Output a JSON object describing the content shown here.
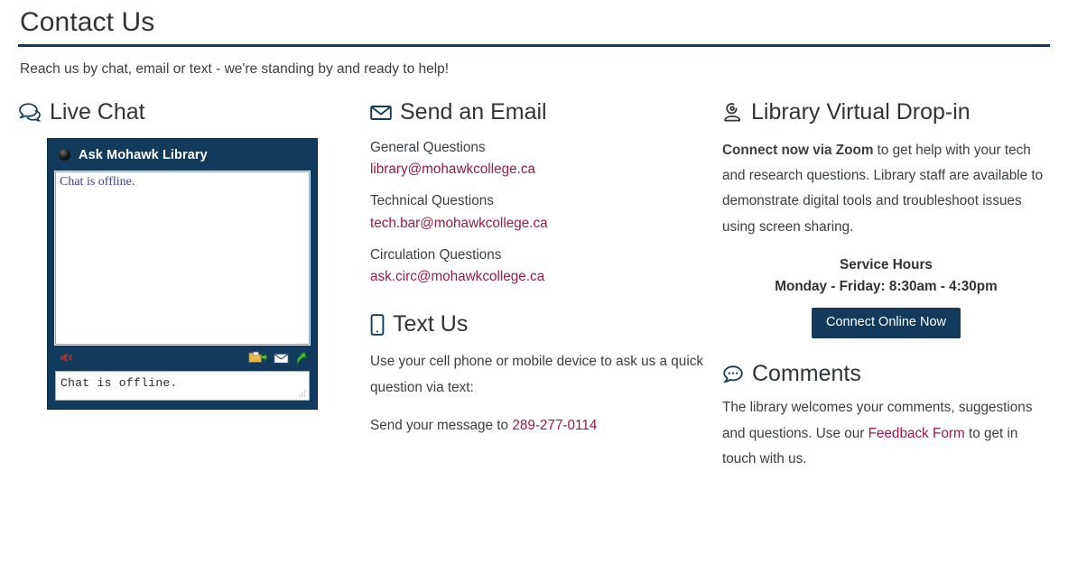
{
  "header": {
    "title": "Contact Us",
    "intro": "Reach us by chat, email or text - we're standing by and ready to help!"
  },
  "colors": {
    "brand_navy": "#123a5c",
    "link_crimson": "#9b1b43",
    "text": "#3a3f42",
    "chat_widget_bg": "#123a5c"
  },
  "live_chat": {
    "heading": "Live Chat",
    "heading_icon": "chat-bubbles-icon",
    "widget": {
      "title": "Ask Mohawk Library",
      "status_icon": "offline-status-dot",
      "transcript_message": "Chat is offline.",
      "input_value": "Chat is offline.",
      "toolbar_icons": [
        "mute-speaker-icon",
        "save-transcript-icon",
        "email-transcript-icon",
        "popout-window-icon"
      ]
    }
  },
  "email": {
    "heading": "Send an Email",
    "heading_icon": "envelope-icon",
    "entries": [
      {
        "label": "General Questions",
        "address": "library@mohawkcollege.ca"
      },
      {
        "label": "Technical Questions",
        "address": "tech.bar@mohawkcollege.ca"
      },
      {
        "label": "Circulation Questions",
        "address": "ask.circ@mohawkcollege.ca"
      }
    ]
  },
  "text_us": {
    "heading": "Text Us",
    "heading_icon": "mobile-phone-icon",
    "body": "Use your cell phone or mobile device to ask us a quick question via text:",
    "send_prefix": "Send your message to ",
    "phone": "289-277-0114"
  },
  "dropin": {
    "heading": "Library Virtual Drop-in",
    "heading_icon": "webcam-icon",
    "body_bold": "Connect now via Zoom",
    "body_rest": " to get help with your tech and research questions. Library staff are available to demonstrate digital tools and troubleshoot issues using screen sharing.",
    "service_hours_label": "Service Hours",
    "service_hours_value": "Monday - Friday: 8:30am - 4:30pm",
    "button_label": "Connect Online Now"
  },
  "comments": {
    "heading": "Comments",
    "heading_icon": "comment-dots-icon",
    "body_before": "The library welcomes your comments, suggestions and questions. Use our ",
    "link_label": "Feedback Form",
    "body_after": " to get in touch with us."
  }
}
